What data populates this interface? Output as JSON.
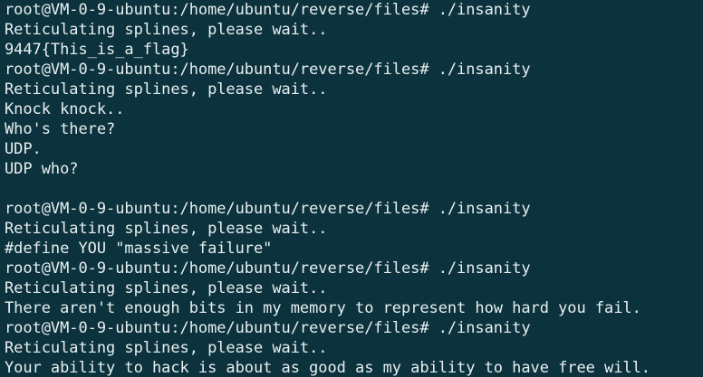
{
  "terminal": {
    "background": "#0b323d",
    "foreground": "#e8eff0",
    "lines": [
      "root@VM-0-9-ubuntu:/home/ubuntu/reverse/files# ./insanity",
      "Reticulating splines, please wait..",
      "9447{This_is_a_flag}",
      "root@VM-0-9-ubuntu:/home/ubuntu/reverse/files# ./insanity",
      "Reticulating splines, please wait..",
      "Knock knock..",
      "Who's there?",
      "UDP.",
      "UDP who?",
      "",
      "root@VM-0-9-ubuntu:/home/ubuntu/reverse/files# ./insanity",
      "Reticulating splines, please wait..",
      "#define YOU \"massive failure\"",
      "root@VM-0-9-ubuntu:/home/ubuntu/reverse/files# ./insanity",
      "Reticulating splines, please wait..",
      "There aren't enough bits in my memory to represent how hard you fail.",
      "root@VM-0-9-ubuntu:/home/ubuntu/reverse/files# ./insanity",
      "Reticulating splines, please wait..",
      "Your ability to hack is about as good as my ability to have free will."
    ]
  }
}
